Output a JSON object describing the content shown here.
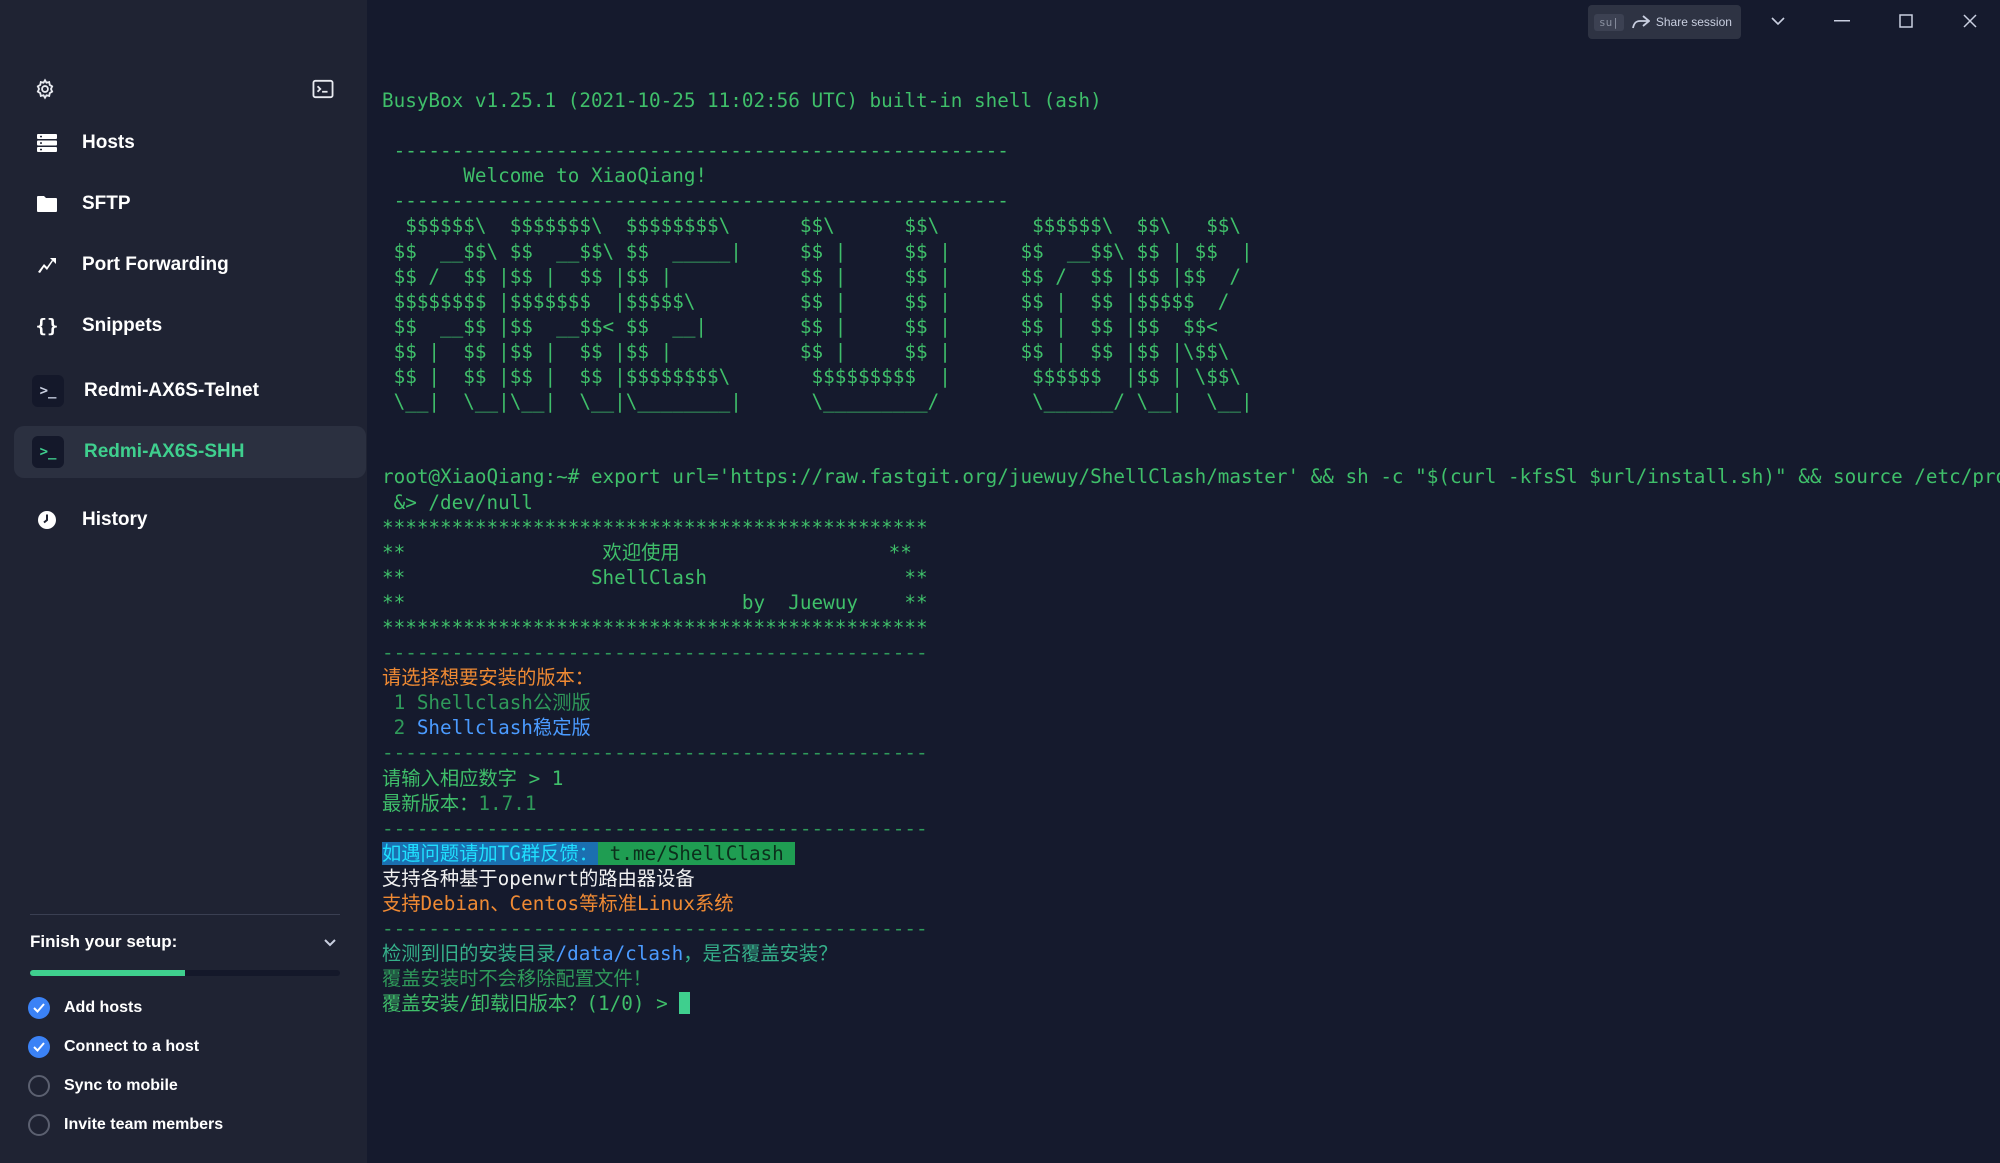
{
  "sidebar": {
    "nav": [
      {
        "label": "Hosts",
        "icon": "hosts-icon"
      },
      {
        "label": "SFTP",
        "icon": "folder-icon"
      },
      {
        "label": "Port Forwarding",
        "icon": "port-forwarding-icon"
      },
      {
        "label": "Snippets",
        "icon": "snippets-icon"
      }
    ],
    "sessions": [
      {
        "label": "Redmi-AX6S-Telnet",
        "active": false
      },
      {
        "label": "Redmi-AX6S-SHH",
        "active": true
      }
    ],
    "history_label": "History",
    "setup": {
      "title": "Finish your setup:",
      "progress": 0.5,
      "items": [
        {
          "label": "Add hosts",
          "done": true
        },
        {
          "label": "Connect to a host",
          "done": true
        },
        {
          "label": "Sync to mobile",
          "done": false
        },
        {
          "label": "Invite team members",
          "done": false
        }
      ]
    }
  },
  "titlebar": {
    "share_label": "Share session",
    "share_pill": "su|"
  },
  "terminal": {
    "lines": [
      [
        {
          "t": "BusyBox v1.25.1 (2021-10-25 11:02:56 UTC) built-in shell (ash)",
          "c": "green"
        }
      ],
      [
        {
          "t": "",
          "c": "green"
        }
      ],
      [
        {
          "t": " -----------------------------------------------------",
          "c": "green"
        }
      ],
      [
        {
          "t": "       Welcome to XiaoQiang!",
          "c": "green"
        }
      ],
      [
        {
          "t": " -----------------------------------------------------",
          "c": "green"
        }
      ],
      [
        {
          "t": "  $$$$$$\\  $$$$$$$\\  $$$$$$$$\\      $$\\      $$\\        $$$$$$\\  $$\\   $$\\",
          "c": "green"
        }
      ],
      [
        {
          "t": " $$  __$$\\ $$  __$$\\ $$  _____|     $$ |     $$ |      $$  __$$\\ $$ | $$  |",
          "c": "green"
        }
      ],
      [
        {
          "t": " $$ /  $$ |$$ |  $$ |$$ |           $$ |     $$ |      $$ /  $$ |$$ |$$  /",
          "c": "green"
        }
      ],
      [
        {
          "t": " $$$$$$$$ |$$$$$$$  |$$$$$\\         $$ |     $$ |      $$ |  $$ |$$$$$  /",
          "c": "green"
        }
      ],
      [
        {
          "t": " $$  __$$ |$$  __$$< $$  __|        $$ |     $$ |      $$ |  $$ |$$  $$<",
          "c": "green"
        }
      ],
      [
        {
          "t": " $$ |  $$ |$$ |  $$ |$$ |           $$ |     $$ |      $$ |  $$ |$$ |\\$$\\",
          "c": "green"
        }
      ],
      [
        {
          "t": " $$ |  $$ |$$ |  $$ |$$$$$$$$\\       $$$$$$$$$  |       $$$$$$  |$$ | \\$$\\",
          "c": "green"
        }
      ],
      [
        {
          "t": " \\__|  \\__|\\__|  \\__|\\________|      \\_________/        \\______/ \\__|  \\__|",
          "c": "green"
        }
      ],
      [
        {
          "t": "",
          "c": "green"
        }
      ],
      [
        {
          "t": "",
          "c": "green"
        }
      ],
      [
        {
          "t": "root@XiaoQiang:~# export url='https://raw.fastgit.org/juewuy/ShellClash/master' && sh -c \"$(curl -kfsSl $url/install.sh)\" && source /etc/profile",
          "c": "green"
        }
      ],
      [
        {
          "t": " &> /dev/null",
          "c": "green"
        }
      ],
      [
        {
          "t": "***********************************************",
          "c": "green"
        }
      ],
      [
        {
          "t": "**                 欢迎使用                  **",
          "c": "green"
        }
      ],
      [
        {
          "t": "**                ShellClash                 **",
          "c": "green"
        }
      ],
      [
        {
          "t": "**                             by  Juewuy    **",
          "c": "green"
        }
      ],
      [
        {
          "t": "***********************************************",
          "c": "green"
        }
      ],
      [
        {
          "t": "-----------------------------------------------",
          "c": "dim"
        }
      ],
      [
        {
          "t": "请选择想要安装的版本：",
          "c": "orange"
        }
      ],
      [
        {
          "t": " 1 Shellclash公测版",
          "c": "dim"
        }
      ],
      [
        {
          "t": " 2 ",
          "c": "dim"
        },
        {
          "t": "Shellclash稳定版",
          "c": "blue"
        }
      ],
      [
        {
          "t": "-----------------------------------------------",
          "c": "dim"
        }
      ],
      [
        {
          "t": "请输入相应数字 > 1",
          "c": "green"
        }
      ],
      [
        {
          "t": "最新版本：",
          "c": "green"
        },
        {
          "t": "1.7.1",
          "c": "dim"
        }
      ],
      [
        {
          "t": "-----------------------------------------------",
          "c": "dim"
        }
      ],
      [
        {
          "t": "如遇问题请加TG群反馈：",
          "c": "hl-blue"
        },
        {
          "t": " t.me/ShellClash ",
          "c": "hl-green"
        }
      ],
      [
        {
          "t": "支持各种基于openwrt的路由器设备",
          "c": "white"
        }
      ],
      [
        {
          "t": "支持Debian、Centos等标准Linux系统",
          "c": "orange"
        }
      ],
      [
        {
          "t": "-----------------------------------------------",
          "c": "dim"
        }
      ],
      [
        {
          "t": "检测到旧的安装目录",
          "c": "teal"
        },
        {
          "t": "/data/clash",
          "c": "blue"
        },
        {
          "t": "，是否覆盖安装？",
          "c": "teal"
        }
      ],
      [
        {
          "t": "覆盖安装时不会移除配置文件！",
          "c": "dim"
        }
      ],
      [
        {
          "t": "覆盖安装/卸载旧版本？(1/0) > ",
          "c": "green"
        }
      ]
    ]
  }
}
